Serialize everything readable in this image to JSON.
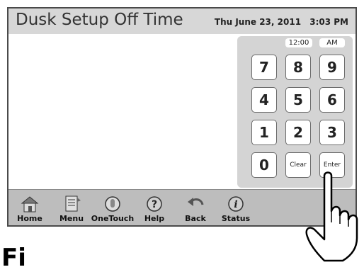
{
  "screen": {
    "title": "Dusk Setup Off Time",
    "date": "Thu June 23, 2011",
    "time": "3:03 PM"
  },
  "keypad": {
    "time_display": "12:00",
    "ampm_display": "AM",
    "keys": [
      "7",
      "8",
      "9",
      "4",
      "5",
      "6",
      "1",
      "2",
      "3",
      "0",
      "Clear",
      "Enter"
    ]
  },
  "toolbar": {
    "items": [
      {
        "label": "Home",
        "icon": "home-icon"
      },
      {
        "label": "Menu",
        "icon": "menu-icon"
      },
      {
        "label": "OneTouch",
        "icon": "onetouch-icon"
      },
      {
        "label": "Help",
        "icon": "help-icon"
      },
      {
        "label": "Back",
        "icon": "back-icon"
      },
      {
        "label": "Status",
        "icon": "status-icon"
      }
    ]
  },
  "page_heading": "Fi",
  "colors": {
    "titlebar": "#d7d7d7",
    "keypad": "#d4d4d4",
    "toolbar": "#bdbdbd",
    "border": "#4a4a4a"
  }
}
